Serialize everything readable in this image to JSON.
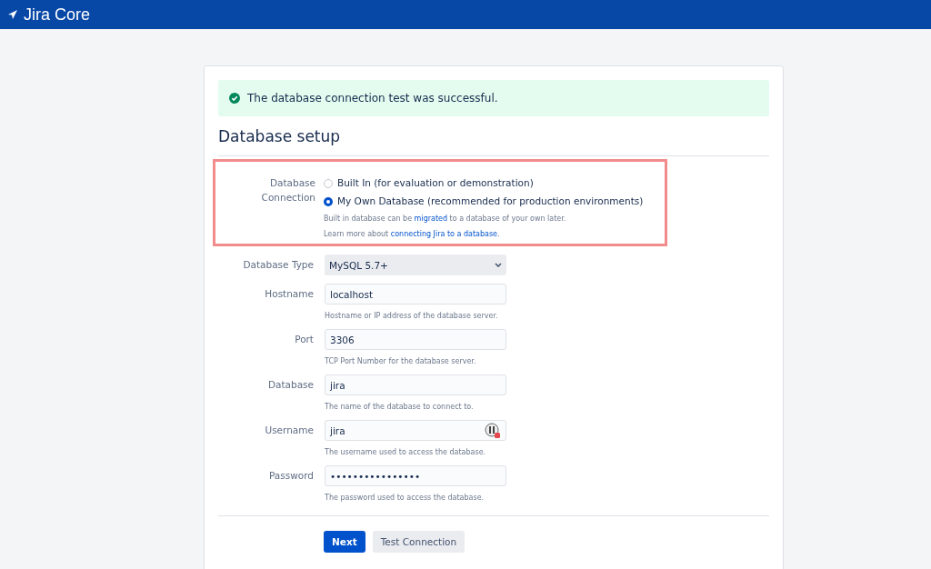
{
  "header": {
    "product": "Jira Core"
  },
  "banner": {
    "kind": "success",
    "message": "The database connection test was successful."
  },
  "heading": "Database setup",
  "connection": {
    "label_lines": [
      "Database",
      "Connection"
    ],
    "highlighted": true,
    "options": [
      {
        "label": "Built In (for evaluation or demonstration)",
        "selected": false
      },
      {
        "label": "My Own Database (recommended for production environments)",
        "selected": true
      }
    ],
    "notes": [
      {
        "before": "Built in database can be ",
        "link": "migrated",
        "after": " to a database of your own later."
      },
      {
        "before": "Learn more about ",
        "link": "connecting Jira to a database",
        "after": "."
      }
    ]
  },
  "fields": [
    {
      "kind": "select",
      "label": "Database Type",
      "value": "MySQL 5.7+"
    },
    {
      "kind": "text",
      "label": "Hostname",
      "value": "localhost",
      "help": "Hostname or IP address of the database server."
    },
    {
      "kind": "text",
      "label": "Port",
      "value": "3306",
      "help": "TCP Port Number for the database server."
    },
    {
      "kind": "text",
      "label": "Database",
      "value": "jira",
      "help": "The name of the database to connect to."
    },
    {
      "kind": "text",
      "label": "Username",
      "value": "jira",
      "help": "The username used to access the database.",
      "manager_icon": true
    },
    {
      "kind": "text",
      "label": "Password",
      "value": "••••••••••••••••",
      "help": "The password used to access the database."
    }
  ],
  "buttons": [
    {
      "label": "Next",
      "primary": true
    },
    {
      "label": "Test Connection",
      "primary": false
    }
  ]
}
